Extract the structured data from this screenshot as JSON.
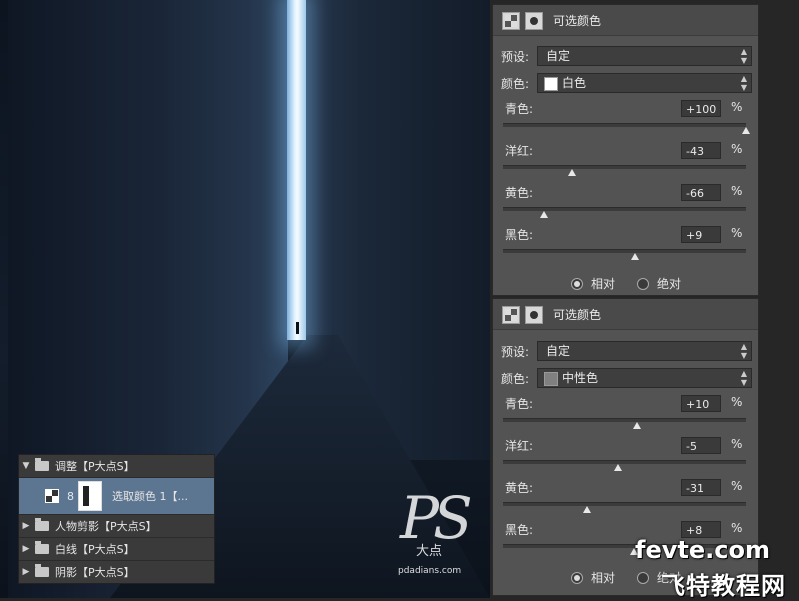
{
  "canvas": {
    "watermark": {
      "ps": "PS",
      "cn": "大点",
      "url": "pdadians.com"
    }
  },
  "layers": {
    "items": [
      {
        "arrow": "▼",
        "name": "调整【P大点S】"
      },
      {
        "name": "选取颜色 1【...",
        "chain": "8"
      },
      {
        "arrow": "▶",
        "name": "人物剪影【P大点S】"
      },
      {
        "arrow": "▶",
        "name": "白线【P大点S】"
      },
      {
        "arrow": "▶",
        "name": "阴影【P大点S】"
      }
    ]
  },
  "panel1": {
    "title": "可选颜色",
    "preset_label": "预设:",
    "preset_value": "自定",
    "color_label": "颜色:",
    "color_value": "白色",
    "color_swatch": "#ffffff",
    "sliders": [
      {
        "label": "青色:",
        "value": "+100",
        "percent": 100
      },
      {
        "label": "洋红:",
        "value": "-43",
        "percent": -43
      },
      {
        "label": "黄色:",
        "value": "-66",
        "percent": -66
      },
      {
        "label": "黑色:",
        "value": "+9",
        "percent": 9
      }
    ],
    "pct": "%",
    "radio_relative": "相对",
    "radio_absolute": "绝对",
    "selected": "relative"
  },
  "panel2": {
    "title": "可选颜色",
    "preset_label": "预设:",
    "preset_value": "自定",
    "color_label": "颜色:",
    "color_value": "中性色",
    "color_swatch": "#808080",
    "sliders": [
      {
        "label": "青色:",
        "value": "+10",
        "percent": 10
      },
      {
        "label": "洋红:",
        "value": "-5",
        "percent": -5
      },
      {
        "label": "黄色:",
        "value": "-31",
        "percent": -31
      },
      {
        "label": "黑色:",
        "value": "+8",
        "percent": 8
      }
    ],
    "pct": "%",
    "radio_relative": "相对",
    "radio_absolute": "绝对",
    "selected": "relative"
  },
  "site": {
    "line1": "fevte.com",
    "line2": "飞特教程网"
  },
  "icons": {
    "adjustment": "adjustment-layer-icon",
    "mask": "mask-icon",
    "folder": "folder-icon",
    "updown": "updown-arrows-icon"
  }
}
